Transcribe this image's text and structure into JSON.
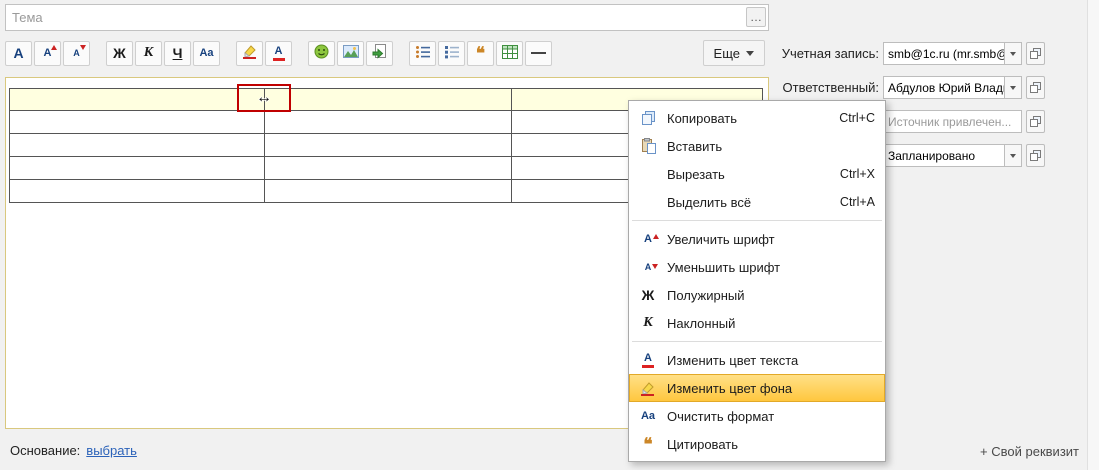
{
  "subject": {
    "placeholder": "Тема",
    "expand": "…"
  },
  "toolbar": {
    "more": "Еще"
  },
  "icons": {
    "font": "А",
    "bold": "Ж",
    "italic": "К",
    "underline": "Ч",
    "clear": "Aa",
    "quote": "❝",
    "resize_cursor": "↔"
  },
  "fields": {
    "account": {
      "label": "Учетная запись:",
      "value": "smb@1c.ru (mr.smb@"
    },
    "responsible": {
      "label": "Ответственный:",
      "value": "Абдулов Юрий Влади"
    },
    "source": {
      "placeholder": "Источник привлечен..."
    },
    "status": {
      "value": "Запланировано"
    }
  },
  "context_menu": {
    "items": [
      {
        "label": "Копировать",
        "shortcut": "Ctrl+C"
      },
      {
        "label": "Вставить",
        "shortcut": ""
      },
      {
        "label": "Вырезать",
        "shortcut": "Ctrl+X"
      },
      {
        "label": "Выделить всё",
        "shortcut": "Ctrl+A"
      },
      {
        "label": "Увеличить шрифт",
        "shortcut": ""
      },
      {
        "label": "Уменьшить шрифт",
        "shortcut": ""
      },
      {
        "label": "Полужирный",
        "shortcut": ""
      },
      {
        "label": "Наклонный",
        "shortcut": ""
      },
      {
        "label": "Изменить цвет текста",
        "shortcut": ""
      },
      {
        "label": "Изменить цвет фона",
        "shortcut": "",
        "highlighted": true
      },
      {
        "label": "Очистить формат",
        "shortcut": ""
      },
      {
        "label": "Цитировать",
        "shortcut": ""
      }
    ]
  },
  "footer": {
    "basis_label": "Основание:",
    "basis_link": "выбрать",
    "custom_attr": "+ Свой реквизит"
  },
  "colors": {
    "menu_highlight": "#ffc63c",
    "table_header_bg": "#ffffe0",
    "resize_outline": "#c00000",
    "link": "#2b62b9",
    "editor_border": "#d9c87e"
  }
}
